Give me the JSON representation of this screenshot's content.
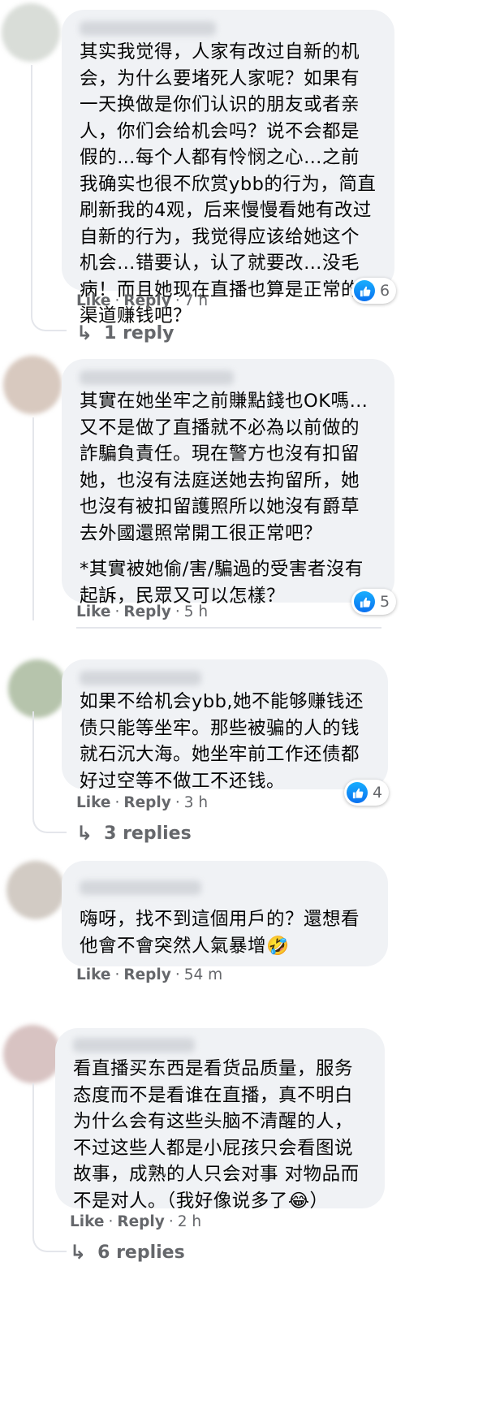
{
  "colors": {
    "bubble": "#f0f2f5",
    "meta_text": "#65676b",
    "like_blue": "#1877f2"
  },
  "comments": [
    {
      "lines": [
        "其实我觉得，人家有改过自新的机会，为什么要堵死人家呢？如果有一天换做是你们认识的朋友或者亲人，你们会给机会吗？说不会都是假的…每个人都有怜悯之心…之前我确实也很不欣赏ybb的行为，简直刷新我的4观，后来慢慢看她有改过自新的行为，我觉得应该给她这个机会…错要认，认了就要改…没毛病！而且她现在直播也算是正常的渠道赚钱吧？"
      ],
      "reaction_icon": "like-icon",
      "reaction_count": "6",
      "like": "Like",
      "reply": "Reply",
      "time": "7 h",
      "replies": "1 reply"
    },
    {
      "lines": [
        "其實在她坐牢之前賺點錢也OK嗎…又不是做了直播就不必為以前做的詐騙負責任。現在警方也沒有扣留她，也沒有法庭送她去拘留所，她也沒有被扣留護照所以她沒有爵草去外國還照常開工很正常吧？",
        "*其實被她偷/害/騙過的受害者沒有起訴，民眾又可以怎樣？"
      ],
      "reaction_icon": "like-icon",
      "reaction_count": "5",
      "like": "Like",
      "reply": "Reply",
      "time": "5 h"
    },
    {
      "lines": [
        "如果不给机会ybb,她不能够赚钱还债只能等坐牢。那些被骗的人的钱就石沉大海。她坐牢前工作还债都好过空等不做工不还钱。"
      ],
      "reaction_icon": "like-icon",
      "reaction_count": "4",
      "like": "Like",
      "reply": "Reply",
      "time": "3 h",
      "replies": "3 replies"
    },
    {
      "lines": [
        "嗨呀，找不到這個用戶的？還想看他會不會突然人氣暴增🤣"
      ],
      "like": "Like",
      "reply": "Reply",
      "time": "54 m"
    },
    {
      "lines": [
        "看直播买东西是看货品质量，服务态度而不是看谁在直播，真不明白为什么会有这些头脑不清醒的人，不过这些人都是小屁孩只会看图说故事，成熟的人只会对事 对物品而不是对人。（我好像说多了😂）"
      ],
      "like": "Like",
      "reply": "Reply",
      "time": "2 h",
      "replies": "6 replies"
    }
  ]
}
